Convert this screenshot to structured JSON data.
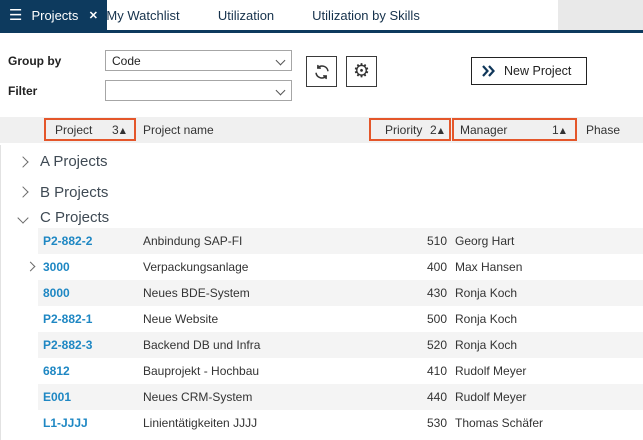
{
  "icons": {
    "menu": "☰",
    "close": "✕",
    "gear": "⚙",
    "sort_asc": "▲"
  },
  "colors": {
    "navy": "#0d3a5e",
    "link_blue": "#1e87c3",
    "highlight_orange": "#e4562a",
    "header_bg": "#f0f0f0",
    "stripe_bg": "#f4f4f4"
  },
  "tabs": {
    "active": {
      "label": "Projects"
    },
    "items": [
      {
        "label": "My Watchlist"
      },
      {
        "label": "Utilization"
      },
      {
        "label": "Utilization by Skills"
      }
    ]
  },
  "toolbar": {
    "group_by_label": "Group by",
    "group_by_value": "Code",
    "filter_label": "Filter",
    "filter_value": "",
    "new_project_label": "New Project"
  },
  "table": {
    "columns": [
      {
        "label": "Project",
        "sort_order": "3",
        "highlighted": true
      },
      {
        "label": "Project name",
        "sort_order": "",
        "highlighted": false
      },
      {
        "label": "Priority",
        "sort_order": "2",
        "highlighted": true
      },
      {
        "label": "Manager",
        "sort_order": "1",
        "highlighted": true
      },
      {
        "label": "Phase",
        "sort_order": "",
        "highlighted": false
      }
    ],
    "groups": [
      {
        "label": "A Projects",
        "expanded": false
      },
      {
        "label": "B Projects",
        "expanded": false
      },
      {
        "label": "C Projects",
        "expanded": true
      }
    ],
    "rows": [
      {
        "project": "P2-882-2",
        "name": "Anbindung SAP-FI",
        "priority": "510",
        "manager": "Georg Hart",
        "phase": "",
        "expandable": false
      },
      {
        "project": "3000",
        "name": "Verpackungsanlage",
        "priority": "400",
        "manager": "Max Hansen",
        "phase": "",
        "expandable": true
      },
      {
        "project": "8000",
        "name": "Neues BDE-System",
        "priority": "430",
        "manager": "Ronja Koch",
        "phase": "",
        "expandable": false
      },
      {
        "project": "P2-882-1",
        "name": "Neue Website",
        "priority": "500",
        "manager": "Ronja Koch",
        "phase": "",
        "expandable": false
      },
      {
        "project": "P2-882-3",
        "name": "Backend DB und Infra",
        "priority": "520",
        "manager": "Ronja Koch",
        "phase": "",
        "expandable": false
      },
      {
        "project": "6812",
        "name": "Bauprojekt - Hochbau",
        "priority": "410",
        "manager": "Rudolf Meyer",
        "phase": "",
        "expandable": false
      },
      {
        "project": "E001",
        "name": "Neues CRM-System",
        "priority": "440",
        "manager": "Rudolf Meyer",
        "phase": "",
        "expandable": false
      },
      {
        "project": "L1-JJJJ",
        "name": "Linientätigkeiten JJJJ",
        "priority": "530",
        "manager": "Thomas Schäfer",
        "phase": "",
        "expandable": false
      }
    ]
  }
}
